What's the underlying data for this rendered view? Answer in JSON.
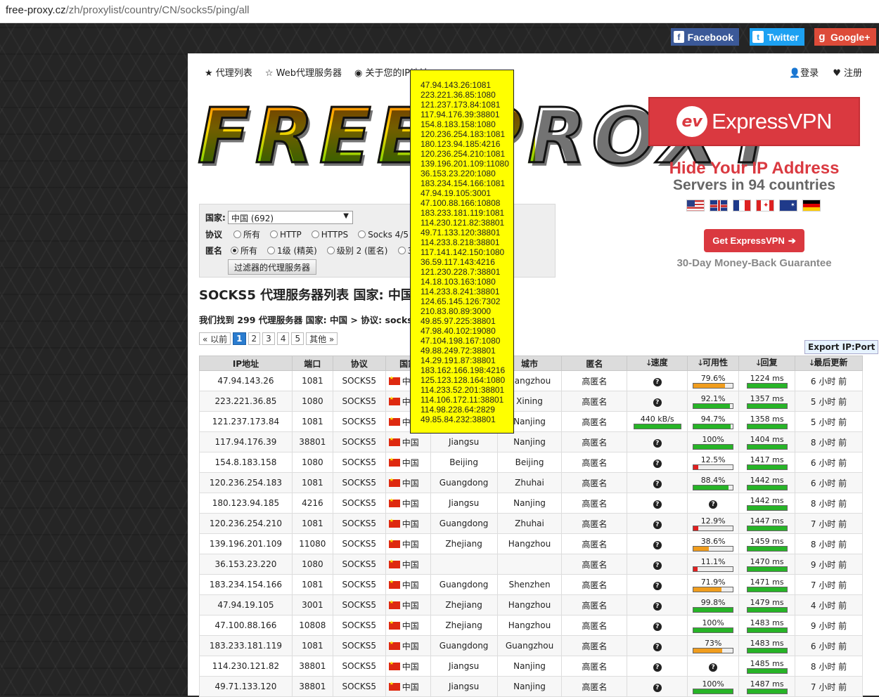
{
  "address_bar": {
    "host": "free-proxy.cz",
    "path": "/zh/proxylist/country/CN/socks5/ping/all"
  },
  "social": {
    "facebook": "Facebook",
    "twitter": "Twitter",
    "google": "Google+"
  },
  "nav": {
    "proxy_list": "代理列表",
    "web_proxy": "Web代理服务器",
    "about_ip": "关于您的IP地址"
  },
  "user_nav": {
    "login": "登录",
    "register": "注册"
  },
  "logo": {
    "text": "FREE PROXY"
  },
  "filter": {
    "country_label": "国家:",
    "country_value": "中国 (692)",
    "protocol_label": "协议",
    "protocol_options": [
      "所有",
      "HTTP",
      "HTTPS",
      "Socks 4/5",
      "S"
    ],
    "anon_label": "匿名",
    "anon_options": [
      "所有",
      "1级 (精英)",
      "级别 2 (匿名)",
      "3级"
    ],
    "button": "过滤器的代理服务器"
  },
  "ad": {
    "brand": "ExpressVPN",
    "headline": "Hide Your IP Address",
    "sub": "Servers in 94 countries",
    "cta": "Get ExpressVPN",
    "guarantee": "30-Day Money-Back Guarantee",
    "colors": {
      "red": "#da3940"
    }
  },
  "heading": {
    "title": "SOCKS5 代理服务器列表 国家: 中国 (",
    "summary": "我们找到 299 代理服务器 国家: 中国 > 协议: socks5"
  },
  "pagination": {
    "prev": "« 以前",
    "pages": [
      "1",
      "2",
      "3",
      "4",
      "5"
    ],
    "more": "其他 »"
  },
  "export_label": "Export IP:Port",
  "table": {
    "headers": [
      "IP地址",
      "端口",
      "协议",
      "国家",
      "",
      "城市",
      "匿名",
      "速度",
      "可用性",
      "回复",
      "最后更新"
    ],
    "rows": [
      {
        "ip": "47.94.143.26",
        "port": "1081",
        "proto": "SOCKS5",
        "country": "中国",
        "region": "",
        "city": "Hangzhou",
        "anon": "高匿名",
        "speed": "",
        "uptime": "79.6%",
        "uptime_val": 79.6,
        "ping": "1224 ms",
        "ping_val": 1224,
        "updated": "6 小时 前"
      },
      {
        "ip": "223.221.36.85",
        "port": "1080",
        "proto": "SOCKS5",
        "country": "中国",
        "region": "",
        "city": "Xining",
        "anon": "高匿名",
        "speed": "",
        "uptime": "92.1%",
        "uptime_val": 92.1,
        "ping": "1357 ms",
        "ping_val": 1357,
        "updated": "5 小时 前"
      },
      {
        "ip": "121.237.173.84",
        "port": "1081",
        "proto": "SOCKS5",
        "country": "中国",
        "region": "",
        "city": "Nanjing",
        "anon": "高匿名",
        "speed": "440 kB/s",
        "uptime": "94.7%",
        "uptime_val": 94.7,
        "ping": "1358 ms",
        "ping_val": 1358,
        "updated": "5 小时 前"
      },
      {
        "ip": "117.94.176.39",
        "port": "38801",
        "proto": "SOCKS5",
        "country": "中国",
        "region": "Jiangsu",
        "city": "Nanjing",
        "anon": "高匿名",
        "speed": "",
        "uptime": "100%",
        "uptime_val": 100,
        "ping": "1404 ms",
        "ping_val": 1404,
        "updated": "8 小时 前"
      },
      {
        "ip": "154.8.183.158",
        "port": "1080",
        "proto": "SOCKS5",
        "country": "中国",
        "region": "Beijing",
        "city": "Beijing",
        "anon": "高匿名",
        "speed": "",
        "uptime": "12.5%",
        "uptime_val": 12.5,
        "ping": "1417 ms",
        "ping_val": 1417,
        "updated": "6 小时 前"
      },
      {
        "ip": "120.236.254.183",
        "port": "1081",
        "proto": "SOCKS5",
        "country": "中国",
        "region": "Guangdong",
        "city": "Zhuhai",
        "anon": "高匿名",
        "speed": "",
        "uptime": "88.4%",
        "uptime_val": 88.4,
        "ping": "1442 ms",
        "ping_val": 1442,
        "updated": "6 小时 前"
      },
      {
        "ip": "180.123.94.185",
        "port": "4216",
        "proto": "SOCKS5",
        "country": "中国",
        "region": "Jiangsu",
        "city": "Nanjing",
        "anon": "高匿名",
        "speed": "",
        "uptime": "",
        "uptime_val": null,
        "ping": "1442 ms",
        "ping_val": 1442,
        "updated": "8 小时 前"
      },
      {
        "ip": "120.236.254.210",
        "port": "1081",
        "proto": "SOCKS5",
        "country": "中国",
        "region": "Guangdong",
        "city": "Zhuhai",
        "anon": "高匿名",
        "speed": "",
        "uptime": "12.9%",
        "uptime_val": 12.9,
        "ping": "1447 ms",
        "ping_val": 1447,
        "updated": "7 小时 前"
      },
      {
        "ip": "139.196.201.109",
        "port": "11080",
        "proto": "SOCKS5",
        "country": "中国",
        "region": "Zhejiang",
        "city": "Hangzhou",
        "anon": "高匿名",
        "speed": "",
        "uptime": "38.6%",
        "uptime_val": 38.6,
        "ping": "1459 ms",
        "ping_val": 1459,
        "updated": "8 小时 前"
      },
      {
        "ip": "36.153.23.220",
        "port": "1080",
        "proto": "SOCKS5",
        "country": "中国",
        "region": "",
        "city": "",
        "anon": "高匿名",
        "speed": "",
        "uptime": "11.1%",
        "uptime_val": 11.1,
        "ping": "1470 ms",
        "ping_val": 1470,
        "updated": "9 小时 前"
      },
      {
        "ip": "183.234.154.166",
        "port": "1081",
        "proto": "SOCKS5",
        "country": "中国",
        "region": "Guangdong",
        "city": "Shenzhen",
        "anon": "高匿名",
        "speed": "",
        "uptime": "71.9%",
        "uptime_val": 71.9,
        "ping": "1471 ms",
        "ping_val": 1471,
        "updated": "7 小时 前"
      },
      {
        "ip": "47.94.19.105",
        "port": "3001",
        "proto": "SOCKS5",
        "country": "中国",
        "region": "Zhejiang",
        "city": "Hangzhou",
        "anon": "高匿名",
        "speed": "",
        "uptime": "99.8%",
        "uptime_val": 99.8,
        "ping": "1479 ms",
        "ping_val": 1479,
        "updated": "4 小时 前"
      },
      {
        "ip": "47.100.88.166",
        "port": "10808",
        "proto": "SOCKS5",
        "country": "中国",
        "region": "Zhejiang",
        "city": "Hangzhou",
        "anon": "高匿名",
        "speed": "",
        "uptime": "100%",
        "uptime_val": 100,
        "ping": "1483 ms",
        "ping_val": 1483,
        "updated": "9 小时 前"
      },
      {
        "ip": "183.233.181.119",
        "port": "1081",
        "proto": "SOCKS5",
        "country": "中国",
        "region": "Guangdong",
        "city": "Guangzhou",
        "anon": "高匿名",
        "speed": "",
        "uptime": "73%",
        "uptime_val": 73,
        "ping": "1483 ms",
        "ping_val": 1483,
        "updated": "6 小时 前"
      },
      {
        "ip": "114.230.121.82",
        "port": "38801",
        "proto": "SOCKS5",
        "country": "中国",
        "region": "Jiangsu",
        "city": "Nanjing",
        "anon": "高匿名",
        "speed": "",
        "uptime": "",
        "uptime_val": null,
        "ping": "1485 ms",
        "ping_val": 1485,
        "updated": "8 小时 前"
      },
      {
        "ip": "49.71.133.120",
        "port": "38801",
        "proto": "SOCKS5",
        "country": "中国",
        "region": "Jiangsu",
        "city": "Nanjing",
        "anon": "高匿名",
        "speed": "",
        "uptime": "100%",
        "uptime_val": 100,
        "ping": "1487 ms",
        "ping_val": 1487,
        "updated": "7 小时 前"
      }
    ]
  },
  "tooltip_list": [
    "47.94.143.26:1081",
    "223.221.36.85:1080",
    "121.237.173.84:1081",
    "117.94.176.39:38801",
    "154.8.183.158:1080",
    "120.236.254.183:1081",
    "180.123.94.185:4216",
    "120.236.254.210:1081",
    "139.196.201.109:11080",
    "36.153.23.220:1080",
    "183.234.154.166:1081",
    "47.94.19.105:3001",
    "47.100.88.166:10808",
    "183.233.181.119:1081",
    "114.230.121.82:38801",
    "49.71.133.120:38801",
    "114.233.8.218:38801",
    "117.141.142.150:1080",
    "36.59.117.143:4216",
    "121.230.228.7:38801",
    "14.18.103.163:1080",
    "114.233.8.241:38801",
    "124.65.145.126:7302",
    "210.83.80.89:3000",
    "49.85.97.225:38801",
    "47.98.40.102:19080",
    "47.104.198.167:1080",
    "49.88.249.72:38801",
    "14.29.191.87:38801",
    "183.162.166.198:4216",
    "125.123.128.164:1080",
    "114.233.52.201:38801",
    "114.106.172.11:38801",
    "114.98.228.64:2829",
    "49.85.84.232:38801"
  ]
}
